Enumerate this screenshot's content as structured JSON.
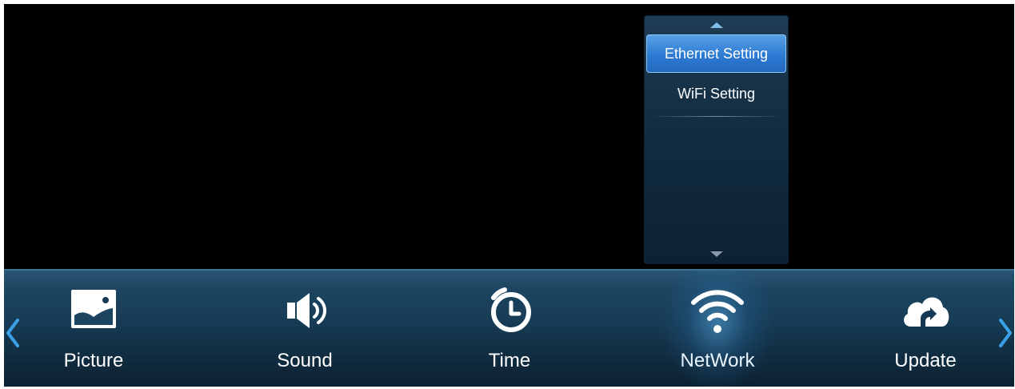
{
  "submenu": {
    "items": [
      {
        "label": "Ethernet Setting",
        "active": true
      },
      {
        "label": "WiFi Setting",
        "active": false
      }
    ]
  },
  "menu_bar": {
    "items": [
      {
        "label": "Picture",
        "icon": "picture-icon"
      },
      {
        "label": "Sound",
        "icon": "speaker-icon"
      },
      {
        "label": "Time",
        "icon": "clock-icon"
      },
      {
        "label": "NetWork",
        "icon": "wifi-icon",
        "selected": true
      },
      {
        "label": "Update",
        "icon": "cloud-upload-icon"
      }
    ]
  },
  "colors": {
    "background": "#000000",
    "bar": "#163a53",
    "highlight": "#2d7ad3",
    "arrow": "#3aa0e8"
  }
}
